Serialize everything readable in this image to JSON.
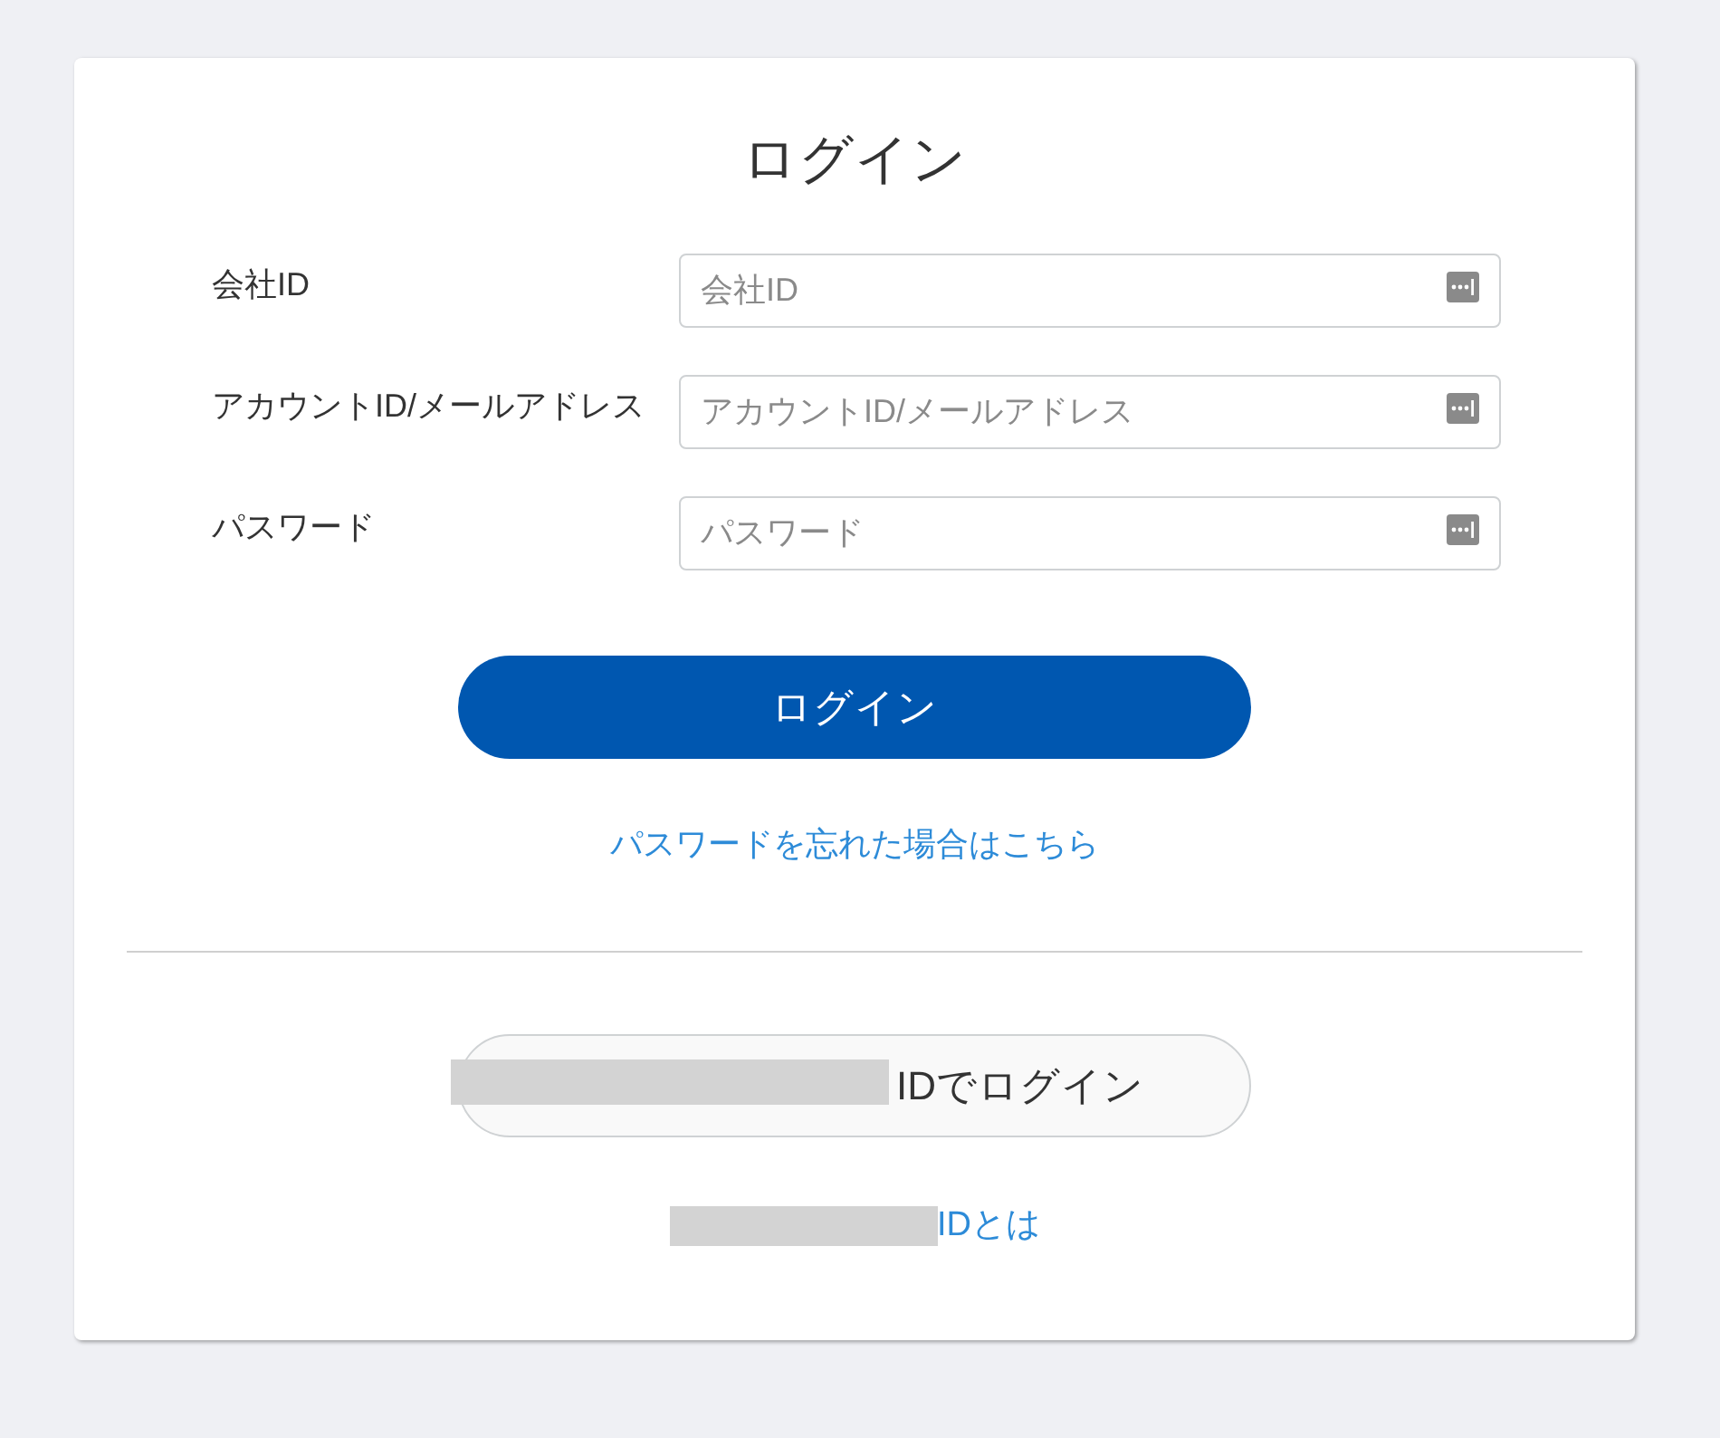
{
  "title": "ログイン",
  "fields": [
    {
      "label": "会社ID",
      "placeholder": "会社ID"
    },
    {
      "label": "アカウントID/メールアドレス",
      "placeholder": "アカウントID/メールアドレス"
    },
    {
      "label": "パスワード",
      "placeholder": "パスワード"
    }
  ],
  "login_button": "ログイン",
  "forgot_password_link": "パスワードを忘れた場合はこちら",
  "sso_button": {
    "label": "IDでログイン",
    "redacted_prefix": true
  },
  "about_link": {
    "label": "IDとは",
    "redacted_prefix": true
  }
}
